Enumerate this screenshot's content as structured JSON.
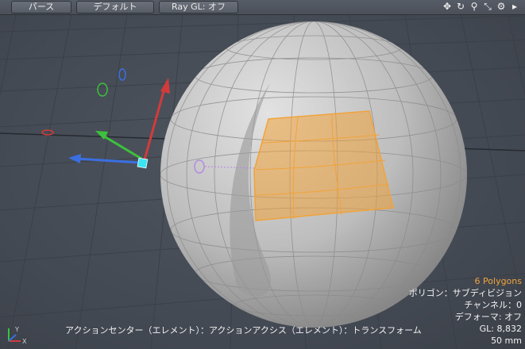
{
  "toolbar": {
    "buttons": [
      {
        "label": "パース"
      },
      {
        "label": "デフォルト"
      },
      {
        "label": "Ray GL: オフ"
      }
    ],
    "icons": [
      "move-icon",
      "rotate-icon",
      "zoom-icon",
      "fit-icon",
      "settings-icon",
      "expand-arrow-icon"
    ]
  },
  "info": {
    "polygons": "6 Polygons",
    "polygon_mode": "ポリゴン：サブディビジョン",
    "channel": "チャンネル：0",
    "deformer": "デフォーマ: オフ",
    "gl": "GL: 8,832",
    "scale": "50 mm"
  },
  "status": {
    "text": "アクションセンター（エレメント）：アクションアクシス（エレメント）：トランスフォーム"
  },
  "colors": {
    "selection": "#f0a33b",
    "x_axis": "#d23b3b",
    "y_axis": "#3cc13c",
    "z_axis": "#3b6fe0",
    "handle": "#39e6f2"
  }
}
